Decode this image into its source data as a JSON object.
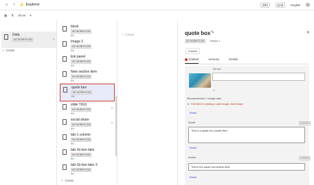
{
  "topbar": {
    "title": "Explorer",
    "chips": [
      "WRI",
      "prod",
      "English"
    ]
  },
  "subbar": {
    "show_label": "Show"
  },
  "col1": {
    "items": [
      {
        "name": "Data",
        "badge": "NO WORKFLOW"
      }
    ],
    "create_label": "Create"
  },
  "col2": {
    "items": [
      {
        "name": "block",
        "badge": "NO WORKFLOW",
        "status": "EN"
      },
      {
        "name": "Image 2",
        "badge": "NO WORKFLOW",
        "status": "EN"
      },
      {
        "name": "link panel",
        "badge": "NO WORKFLOW",
        "status": "EN"
      },
      {
        "name": "New section item",
        "badge": "NO WORKFLOW",
        "status": "EN"
      },
      {
        "name": "quote box",
        "badge": "NO WORKFLOW",
        "status": "EN"
      },
      {
        "name": "slide TIGS",
        "badge": "NO WORKFLOW",
        "status": "EN"
      },
      {
        "name": "social share",
        "badge": "NO WORKFLOW",
        "status": "EN"
      },
      {
        "name": "tab-1 column",
        "badge": "NO WORKFLOW",
        "status": "EN"
      },
      {
        "name": "tab-1b-two tabs",
        "badge": "NO WORKFLOW",
        "status": "EN"
      },
      {
        "name": "tab-1b-two tabs 3",
        "badge": "NO WORKFLOW",
        "status": "EN"
      }
    ],
    "create_label": "Create"
  },
  "col3": {
    "create_label": "Create"
  },
  "editor": {
    "title": "quote box",
    "workflow": "NO WORKFLOW",
    "version": "Version 1",
    "publish_label": "Publish",
    "tabs": [
      "Content",
      "Versions",
      "Details"
    ],
    "alt_label": "Alt text",
    "rec_text": "Recommended: 1 Image ratio",
    "error_text": "This field is missing a valid image. Add image.",
    "reset": "Reset",
    "quote_label": "Quote",
    "quote_badge": "SHARED",
    "quote_value": "This is a quote box Quote field.",
    "author_label": "Author",
    "author_badge": "SHARED",
    "author_value": "This is the quote box Author field"
  }
}
